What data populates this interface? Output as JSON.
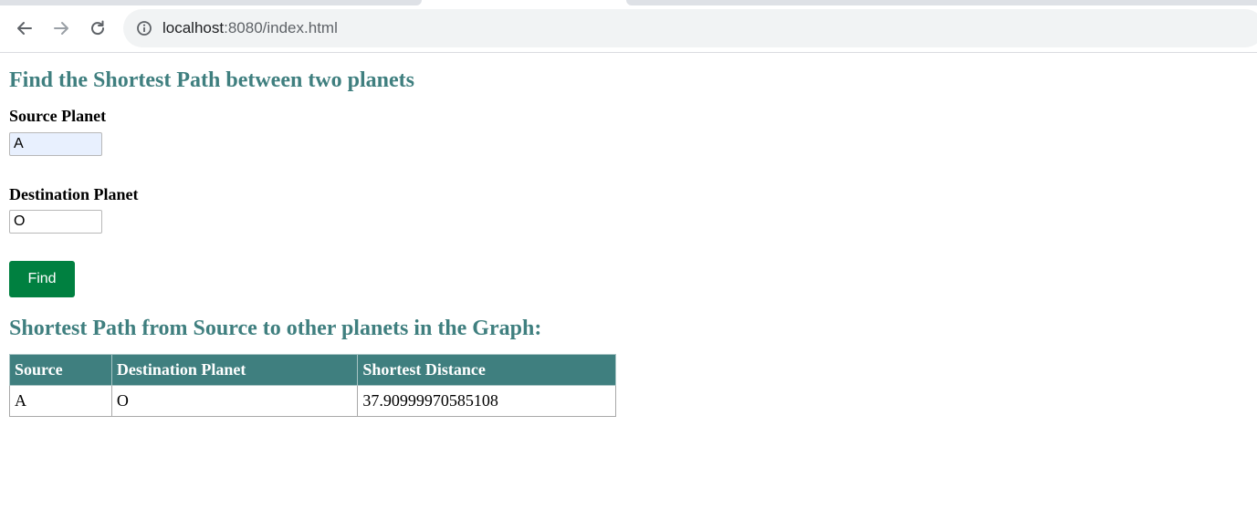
{
  "browser": {
    "url_host": "localhost",
    "url_path": ":8080/index.html"
  },
  "page": {
    "heading": "Find the Shortest Path between two planets",
    "source_label": "Source Planet",
    "source_value": "A",
    "destination_label": "Destination Planet",
    "destination_value": "O",
    "find_label": "Find",
    "results_heading": "Shortest Path from Source to other planets in the Graph:"
  },
  "table": {
    "headers": [
      "Source",
      "Destination Planet",
      "Shortest Distance"
    ],
    "rows": [
      [
        "A",
        "O",
        "37.90999970585108"
      ]
    ]
  }
}
